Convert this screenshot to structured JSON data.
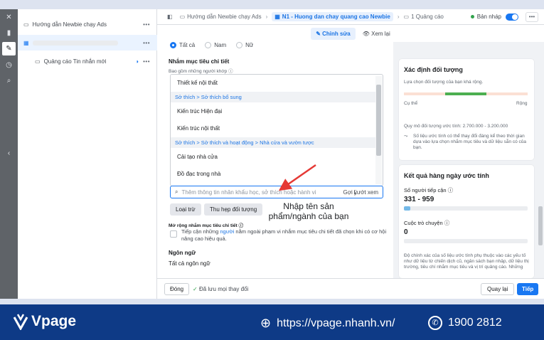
{
  "tree": {
    "campaign": "Hướng dẫn Newbie chạy Ads",
    "ad": "Quảng cáo Tin nhắn mới"
  },
  "topbar": {
    "crumb_campaign": "Hướng dẫn Newbie chạy Ads",
    "crumb_adset": "N1 - Huong dan chay quang cao Newbie",
    "crumb_ads": "1 Quảng cáo",
    "status": "Bản nháp"
  },
  "modes": {
    "edit": "Chỉnh sửa",
    "view": "Xem lại"
  },
  "gender": {
    "all": "Tất cả",
    "male": "Nam",
    "female": "Nữ"
  },
  "targeting": {
    "title": "Nhắm mục tiêu chi tiết",
    "subtitle": "Bao gồm những người khớp",
    "items": [
      {
        "kind": "item",
        "text": "Thiết kế nội thất"
      },
      {
        "kind": "head",
        "text": "Sở thích > Sở thích bổ sung"
      },
      {
        "kind": "item",
        "text": "Kiến trúc Hiện đại"
      },
      {
        "kind": "item",
        "text": "Kiến trúc nội thất"
      },
      {
        "kind": "head",
        "text": "Sở thích > Sở thích và hoạt động > Nhà cửa và vườn tược"
      },
      {
        "kind": "item",
        "text": "Cải tạo nhà cửa"
      },
      {
        "kind": "item",
        "text": "Đồ đạc trong nhà"
      }
    ],
    "search_placeholder": "Thêm thông tin nhân khẩu học, sở thích hoặc hành vi",
    "suggest": "Gợi ý",
    "browse": "Lướt xem",
    "exclude": "Loại trừ",
    "narrow": "Thu hẹp đối tượng",
    "expand_title": "Mở rộng nhắm mục tiêu chi tiết",
    "expand_text_1": "Tiếp cận những ",
    "expand_link": "người",
    "expand_text_2": " nằm ngoài phạm vi nhắm mục tiêu chi tiết đã chọn khi có cơ hội nâng cao hiệu quả.",
    "language_title": "Ngôn ngữ",
    "language_value": "Tất cả ngôn ngữ"
  },
  "annotation": "Nhập tên sản phẩm/ngành của bạn",
  "audience_card": {
    "title": "Xác định đối tượng",
    "desc": "Lựa chọn đối tượng của bạn khá rộng.",
    "specific": "Cụ thể",
    "broad": "Rộng",
    "size": "Quy mô đối tượng ước tính: 2.700.000 - 3.200.000",
    "note": "Số liệu ước tính có thể thay đổi đáng kể theo thời gian dựa vào lựa chọn nhắm mục tiêu và dữ liệu sẵn có của bạn."
  },
  "results_card": {
    "title": "Kết quả hàng ngày ước tính",
    "reach_label": "Số người tiếp cận",
    "reach_value": "331 - 959",
    "reach_fill": 0.05,
    "conv_label": "Cuộc trò chuyện",
    "conv_value": "0",
    "conv_fill": 0.0,
    "footnote": "Độ chính xác của số liệu ước tính phụ thuộc vào các yếu tố như dữ liệu từ chiến dịch cũ, ngân sách bạn nhập, dữ liệu thị trường, tiêu chí nhắm mục tiêu và vị trí quảng cáo. Những"
  },
  "bottom": {
    "close": "Đóng",
    "saved": "Đã lưu mọi thay đổi",
    "back": "Quay lại",
    "next": "Tiếp"
  },
  "footer": {
    "brand": "Vpage",
    "url": "https://vpage.nhanh.vn/",
    "phone": "1900 2812"
  },
  "colors": {
    "accent": "#1877f2",
    "footer": "#0e3a86"
  }
}
